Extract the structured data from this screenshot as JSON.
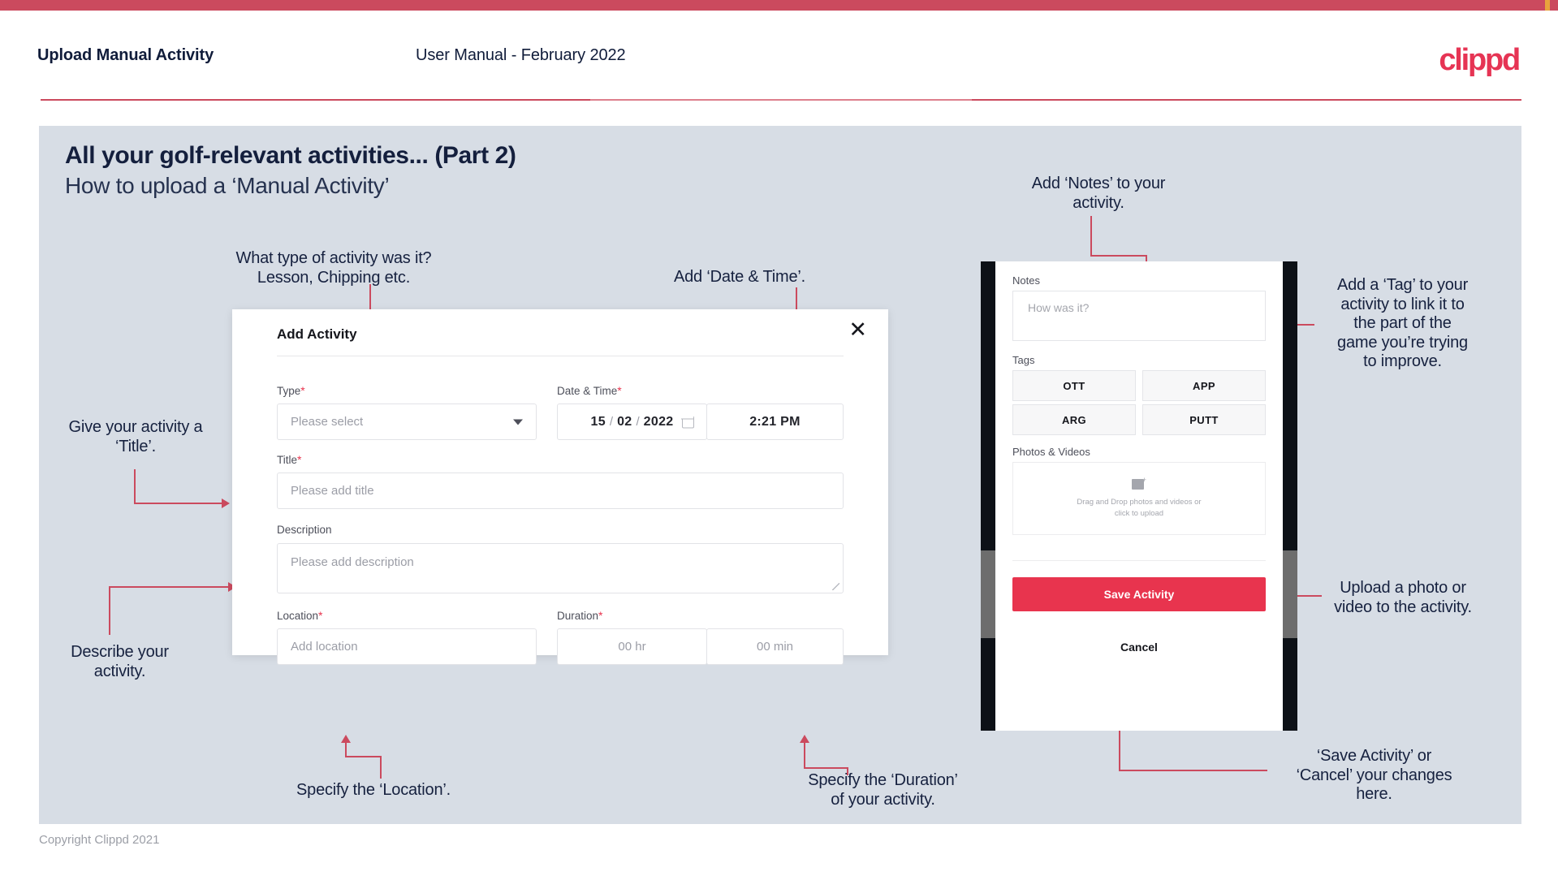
{
  "brand": {
    "accent": "#cb4a5e",
    "logo_text": "clippd",
    "logo_color": "#e63454"
  },
  "header": {
    "title": "Upload Manual Activity",
    "subtitle": "User Manual - February 2022"
  },
  "slide": {
    "title": "All your golf-relevant activities... (Part 2)",
    "subtitle": "How to upload a ‘Manual Activity’"
  },
  "annotations": {
    "type": "What type of activity was it?\nLesson, Chipping etc.",
    "type_l1": "What type of activity was it?",
    "type_l2": "Lesson, Chipping etc.",
    "datetime": "Add ‘Date & Time’.",
    "title_l1": "Give your activity a",
    "title_l2": "‘Title’.",
    "description_l1": "Describe your",
    "description_l2": "activity.",
    "location": "Specify the ‘Location’.",
    "duration_l1": "Specify the ‘Duration’",
    "duration_l2": "of your activity.",
    "notes_l1": "Add ‘Notes’ to your",
    "notes_l2": "activity.",
    "tag_l1": "Add a ‘Tag’ to your",
    "tag_l2": "activity to link it to",
    "tag_l3": "the part of the",
    "tag_l4": "game you’re trying",
    "tag_l5": "to improve.",
    "upload_l1": "Upload a photo or",
    "upload_l2": "video to the activity.",
    "save_l1": "‘Save Activity’ or",
    "save_l2": "‘Cancel’ your changes",
    "save_l3": "here."
  },
  "modal": {
    "title": "Add Activity",
    "close_icon": "✕",
    "fields": {
      "type": {
        "label": "Type",
        "required": "*",
        "placeholder": "Please select"
      },
      "datetime": {
        "label": "Date & Time",
        "required": "*",
        "day": "15",
        "month": "02",
        "year": "2022",
        "separator": "/",
        "time": "2:21 PM"
      },
      "title": {
        "label": "Title",
        "required": "*",
        "placeholder": "Please add title"
      },
      "description": {
        "label": "Description",
        "required": "",
        "placeholder": "Please add description"
      },
      "location": {
        "label": "Location",
        "required": "*",
        "placeholder": "Add location"
      },
      "duration": {
        "label": "Duration",
        "required": "*",
        "hours": "00 hr",
        "minutes": "00 min"
      }
    }
  },
  "phone": {
    "notes": {
      "label": "Notes",
      "placeholder": "How was it?"
    },
    "tags": {
      "label": "Tags",
      "items": [
        "OTT",
        "APP",
        "ARG",
        "PUTT"
      ]
    },
    "photos": {
      "label": "Photos & Videos",
      "drop_l1": "Drag and Drop photos and videos or",
      "drop_l2": "click to upload"
    },
    "save_label": "Save Activity",
    "cancel_label": "Cancel",
    "save_color": "#e8344e"
  },
  "footer": {
    "copyright": "Copyright Clippd 2021"
  }
}
